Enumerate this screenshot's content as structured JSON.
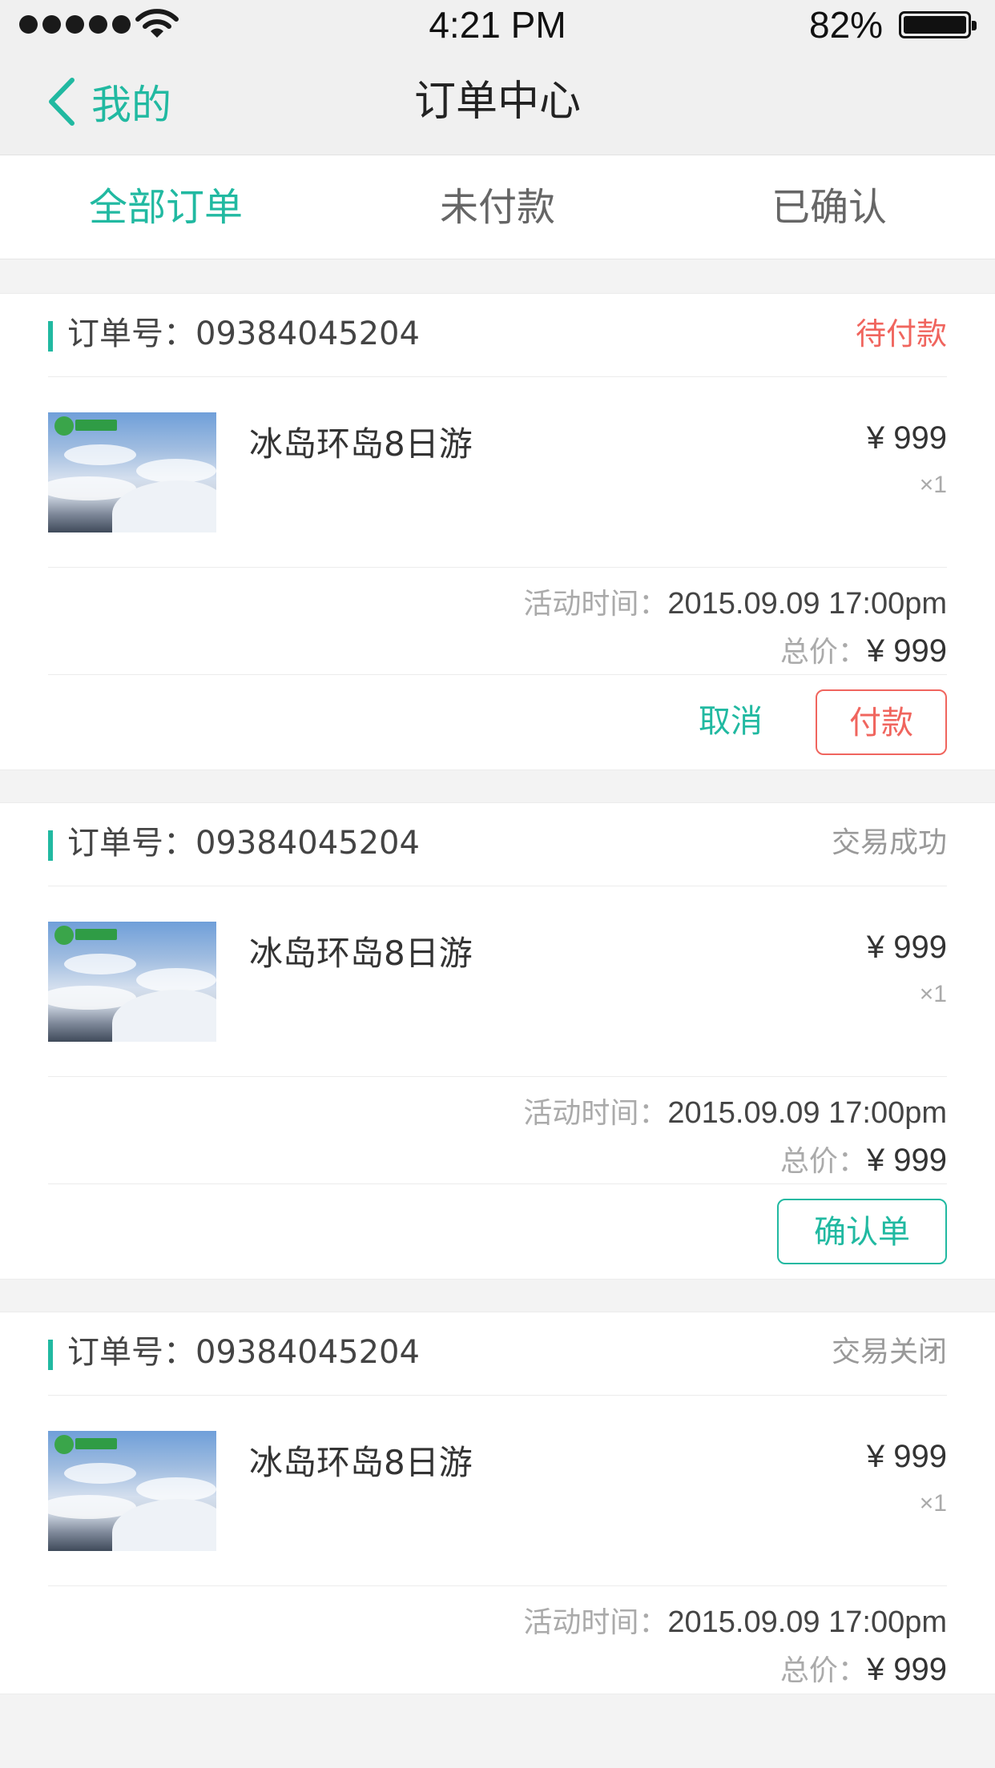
{
  "status_bar": {
    "time": "4:21 PM",
    "battery": "82%"
  },
  "nav": {
    "back_label": "我的",
    "title": "订单中心"
  },
  "tabs": [
    {
      "label": "全部订单",
      "active": true
    },
    {
      "label": "未付款",
      "active": false
    },
    {
      "label": "已确认",
      "active": false
    }
  ],
  "orders": [
    {
      "order_label": "订单号：09384045204",
      "status": "待付款",
      "product_name": "冰岛环岛8日游",
      "price": "¥ 999",
      "qty": "×1",
      "time_label": "活动时间：",
      "time_value": "2015.09.09  17:00pm",
      "total_label": "总价：",
      "total_value": "¥ 999",
      "cancel_label": "取消",
      "pay_label": "付款"
    },
    {
      "order_label": "订单号：09384045204",
      "status": "交易成功",
      "product_name": "冰岛环岛8日游",
      "price": "¥ 999",
      "qty": "×1",
      "time_label": "活动时间：",
      "time_value": "2015.09.09  17:00pm",
      "total_label": "总价：",
      "total_value": "¥ 999",
      "confirm_label": "确认单"
    },
    {
      "order_label": "订单号：09384045204",
      "status": "交易关闭",
      "product_name": "冰岛环岛8日游",
      "price": "¥ 999",
      "qty": "×1",
      "time_label": "活动时间：",
      "time_value": "2015.09.09  17:00pm",
      "total_label": "总价：",
      "total_value": "¥ 999"
    }
  ],
  "colors": {
    "accent": "#21b9a1",
    "alert": "#f0655e",
    "background": "#f3f3f3"
  },
  "icons": [
    "signal-icon",
    "wifi-icon",
    "battery-icon",
    "back-chevron-icon",
    "product-thumbnail"
  ]
}
